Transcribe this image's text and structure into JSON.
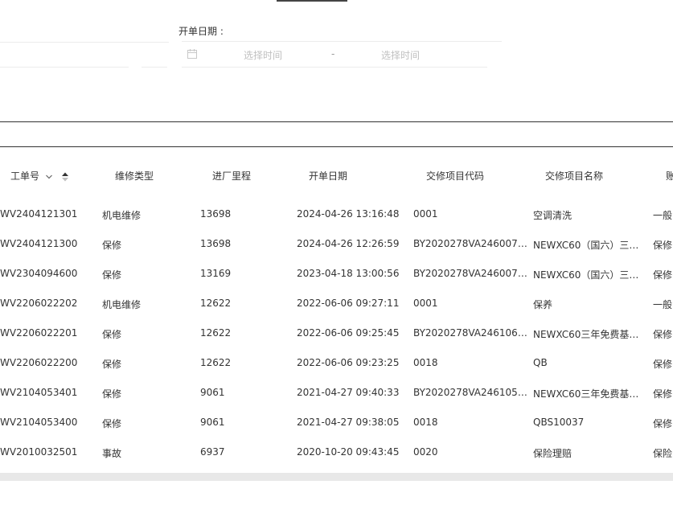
{
  "filters": {
    "open_date_label": "开单日期 :",
    "start_placeholder": "选择时间",
    "separator": "-",
    "end_placeholder": "选择时间"
  },
  "table": {
    "columns": [
      "工单号",
      "维修类型",
      "进厂里程",
      "开单日期",
      "交修项目代码",
      "交修项目名称",
      "账"
    ],
    "rows": [
      [
        "WV2404121301",
        "机电维修",
        "13698",
        "2024-04-26 13:16:48",
        "0001",
        "空调清洗",
        "一般"
      ],
      [
        "WV2404121300",
        "保修",
        "13698",
        "2024-04-26 12:26:59",
        "BY2020278VA2460076M…",
        "NEWXC60（国六）三年…",
        "保修"
      ],
      [
        "WV2304094600",
        "保修",
        "13169",
        "2023-04-18 13:00:56",
        "BY2020278VA2460075M…",
        "NEWXC60（国六）三年…",
        "保修"
      ],
      [
        "WV2206022202",
        "机电维修",
        "12622",
        "2022-06-06 09:27:11",
        "0001",
        "保养",
        "一般"
      ],
      [
        "WV2206022201",
        "保修",
        "12622",
        "2022-06-06 09:25:45",
        "BY2020278VA246106MF…",
        "NEWXC60三年免费基础…",
        "保修"
      ],
      [
        "WV2206022200",
        "保修",
        "12622",
        "2022-06-06 09:23:25",
        "0018",
        "QB",
        "保修"
      ],
      [
        "WV2104053401",
        "保修",
        "9061",
        "2021-04-27 09:40:33",
        "BY2020278VA246105MF…",
        "NEWXC60三年免费基础…",
        "保修"
      ],
      [
        "WV2104053400",
        "保修",
        "9061",
        "2021-04-27 09:38:05",
        "0018",
        "QBS10037",
        "保修"
      ],
      [
        "WV2010032501",
        "事故",
        "6937",
        "2020-10-20 09:43:45",
        "0020",
        "保险理赔",
        "保险"
      ]
    ]
  }
}
